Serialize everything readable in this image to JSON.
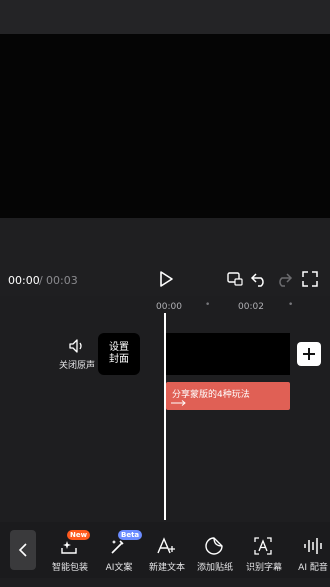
{
  "player": {
    "current_time": "00:00",
    "separator": "/",
    "duration": "00:03"
  },
  "timeline": {
    "ruler": [
      {
        "label": "00:00",
        "type": "time"
      },
      {
        "label": "•",
        "type": "dot"
      },
      {
        "label": "00:02",
        "type": "time"
      },
      {
        "label": "•",
        "type": "dot"
      }
    ],
    "mute_label": "关闭原声",
    "cover_label_line1": "设置",
    "cover_label_line2": "封面",
    "text_clip_label": "分享蒙版的4种玩法"
  },
  "toolbar": {
    "items": [
      {
        "label": "智能包装",
        "icon": "smart-package-icon",
        "badge": "New",
        "badge_color": "#ff5a1f"
      },
      {
        "label": "AI文案",
        "icon": "ai-copy-icon",
        "badge": "Beta",
        "badge_color": "#6b8cff"
      },
      {
        "label": "新建文本",
        "icon": "new-text-icon"
      },
      {
        "label": "添加贴纸",
        "icon": "sticker-icon"
      },
      {
        "label": "识别字幕",
        "icon": "caption-icon"
      },
      {
        "label": "AI 配音",
        "icon": "ai-voice-icon"
      }
    ]
  },
  "colors": {
    "text_clip": "#e06055",
    "background": "#1e1e20"
  }
}
